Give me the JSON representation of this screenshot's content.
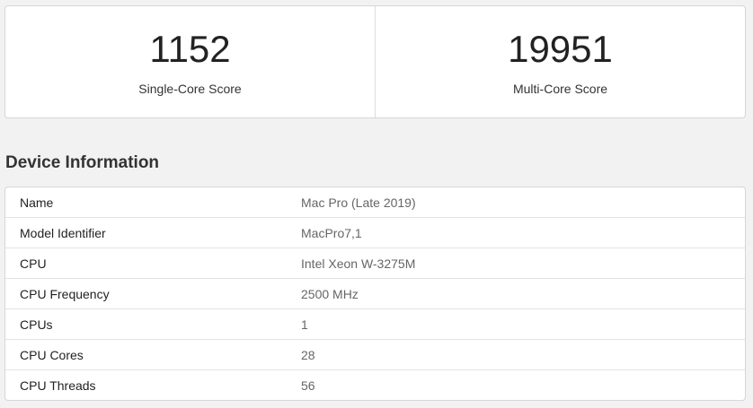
{
  "scores": {
    "single_core": {
      "value": "1152",
      "label": "Single-Core Score"
    },
    "multi_core": {
      "value": "19951",
      "label": "Multi-Core Score"
    }
  },
  "device_info": {
    "title": "Device Information",
    "rows": [
      {
        "name": "Name",
        "value": "Mac Pro (Late 2019)"
      },
      {
        "name": "Model Identifier",
        "value": "MacPro7,1"
      },
      {
        "name": "CPU",
        "value": "Intel Xeon W-3275M"
      },
      {
        "name": "CPU Frequency",
        "value": "2500 MHz"
      },
      {
        "name": "CPUs",
        "value": "1"
      },
      {
        "name": "CPU Cores",
        "value": "28"
      },
      {
        "name": "CPU Threads",
        "value": "56"
      }
    ]
  }
}
